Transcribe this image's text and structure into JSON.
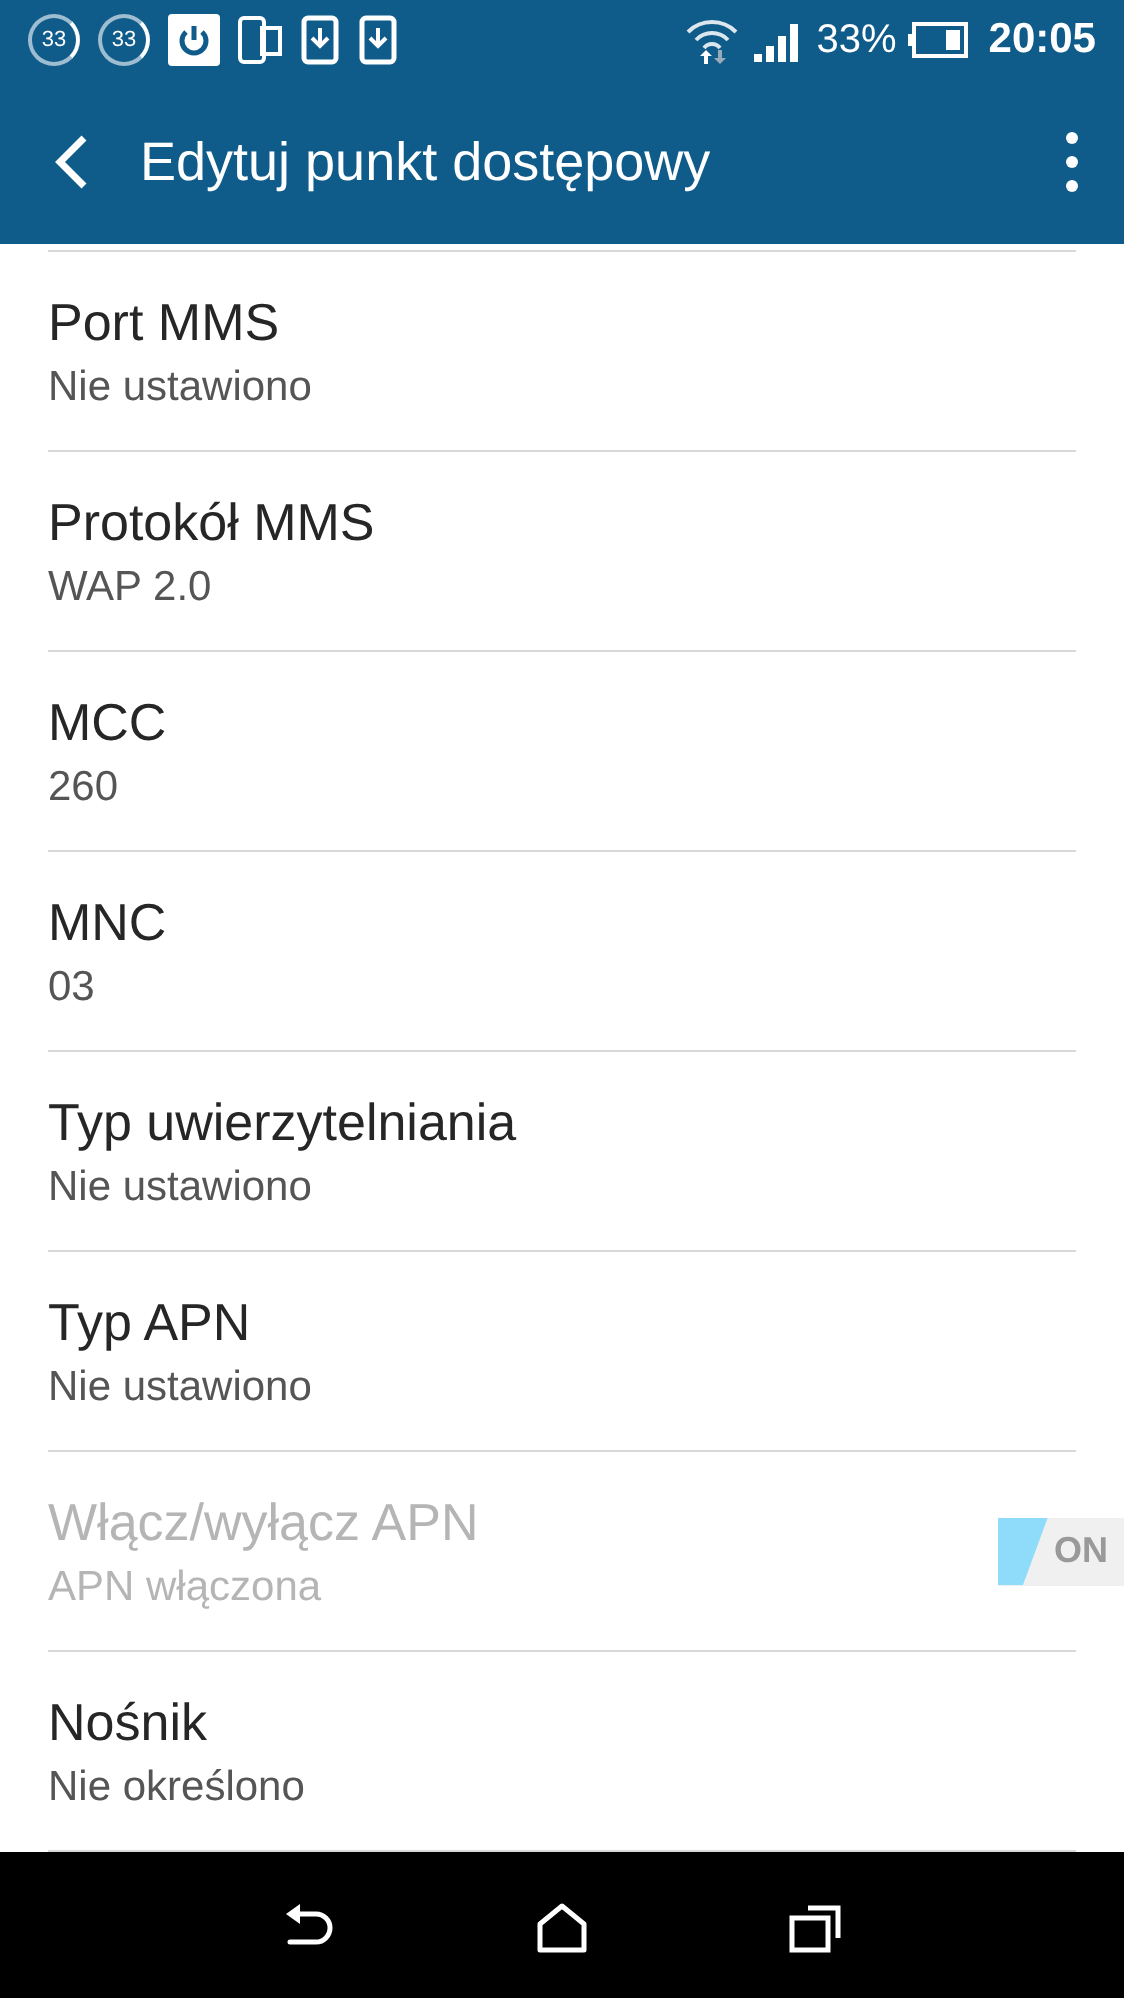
{
  "status_bar": {
    "badges": [
      "33",
      "33"
    ],
    "battery_percent": "33%",
    "time": "20:05"
  },
  "app_bar": {
    "title": "Edytuj punkt dostępowy"
  },
  "items": [
    {
      "kind": "text",
      "title": "Port MMS",
      "summary": "Nie ustawiono",
      "disabled": false
    },
    {
      "kind": "text",
      "title": "Protokół MMS",
      "summary": "WAP 2.0",
      "disabled": false
    },
    {
      "kind": "text",
      "title": "MCC",
      "summary": "260",
      "disabled": false
    },
    {
      "kind": "text",
      "title": "MNC",
      "summary": "03",
      "disabled": false
    },
    {
      "kind": "text",
      "title": "Typ uwierzytelniania",
      "summary": "Nie ustawiono",
      "disabled": false
    },
    {
      "kind": "text",
      "title": "Typ APN",
      "summary": "Nie ustawiono",
      "disabled": false
    },
    {
      "kind": "toggle",
      "title": "Włącz/wyłącz APN",
      "summary": "APN włączona",
      "disabled": true,
      "on": true,
      "toggle_label": "ON"
    },
    {
      "kind": "text",
      "title": "Nośnik",
      "summary": "Nie określono",
      "disabled": false
    }
  ]
}
